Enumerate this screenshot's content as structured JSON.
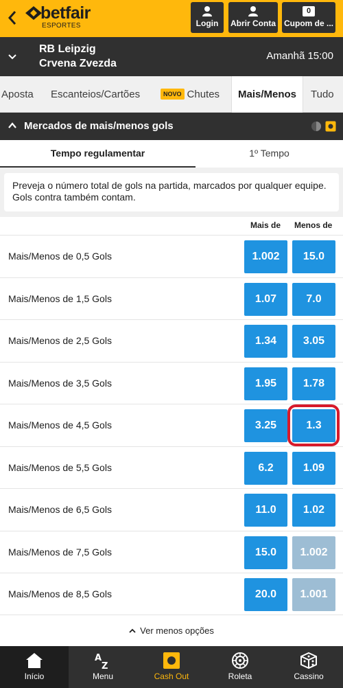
{
  "brand": {
    "name": "betfair",
    "sub": "ESPORTES",
    "accent": "#ffb80c",
    "dark": "#303030",
    "odds_blue": "#1f93e0"
  },
  "header": {
    "back_icon": "chevron-left-icon",
    "login_label": "Login",
    "abrir_conta_label": "Abrir Conta",
    "cupom_label": "Cupom de ...",
    "cupom_count": "0"
  },
  "event": {
    "team1": "RB Leipzig",
    "team2": "Crvena Zvezda",
    "time": "Amanhã 15:00"
  },
  "tabs": [
    {
      "label": "Aposta"
    },
    {
      "label": "Escanteios/Cartões"
    },
    {
      "label": "Chutes",
      "badge": "NOVO"
    },
    {
      "label": "Mais/Menos",
      "active": true
    },
    {
      "label": "Tudo"
    }
  ],
  "section": {
    "title": "Mercados de mais/menos gols"
  },
  "periods": [
    {
      "label": "Tempo regulamentar",
      "active": true
    },
    {
      "label": "1º Tempo"
    }
  ],
  "info": "Preveja o número total de gols na partida, marcados por qualquer equipe. Gols contra também contam.",
  "columns": {
    "over": "Mais de",
    "under": "Menos de"
  },
  "markets": [
    {
      "label": "Mais/Menos de 0,5 Gols",
      "over": "1.002",
      "under": "15.0"
    },
    {
      "label": "Mais/Menos de 1,5 Gols",
      "over": "1.07",
      "under": "7.0"
    },
    {
      "label": "Mais/Menos de 2,5 Gols",
      "over": "1.34",
      "under": "3.05"
    },
    {
      "label": "Mais/Menos de 3,5 Gols",
      "over": "1.95",
      "under": "1.78"
    },
    {
      "label": "Mais/Menos de 4,5 Gols",
      "over": "3.25",
      "under": "1.3",
      "highlight_under": true
    },
    {
      "label": "Mais/Menos de 5,5 Gols",
      "over": "6.2",
      "under": "1.09"
    },
    {
      "label": "Mais/Menos de 6,5 Gols",
      "over": "11.0",
      "under": "1.02"
    },
    {
      "label": "Mais/Menos de 7,5 Gols",
      "over": "15.0",
      "under": "1.002",
      "under_suspended": true
    },
    {
      "label": "Mais/Menos de 8,5 Gols",
      "over": "20.0",
      "under": "1.001",
      "under_suspended": true
    }
  ],
  "ver_menos": "Ver menos opções",
  "bottom_nav": [
    {
      "label": "Início",
      "icon": "home-icon",
      "active": true
    },
    {
      "label": "Menu",
      "icon": "az-icon"
    },
    {
      "label": "Cash Out",
      "icon": "cashout-icon"
    },
    {
      "label": "Roleta",
      "icon": "roulette-icon"
    },
    {
      "label": "Cassino",
      "icon": "dice-icon"
    }
  ]
}
